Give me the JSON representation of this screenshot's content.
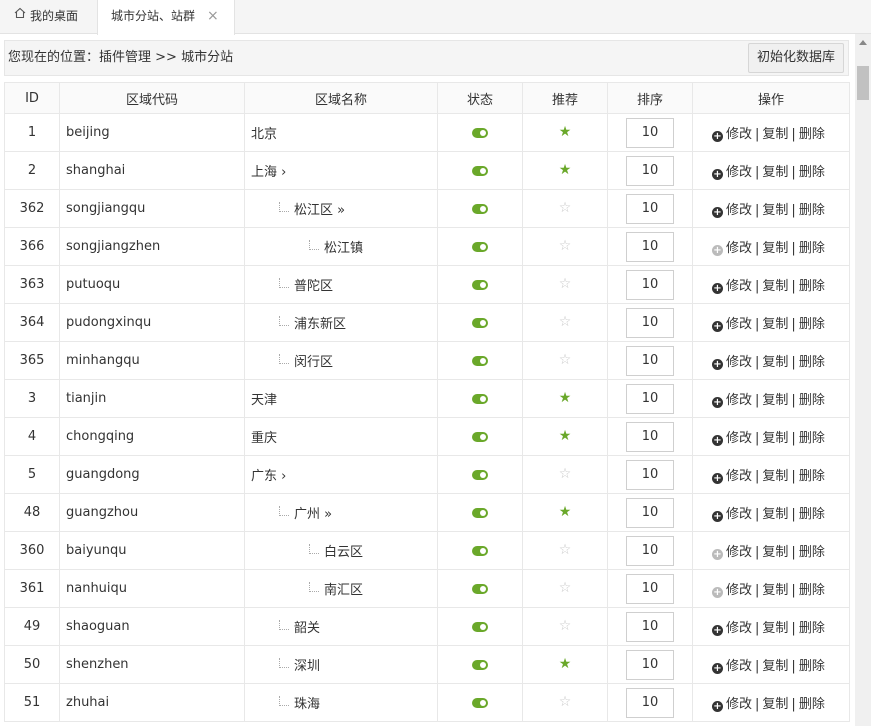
{
  "tabs": {
    "home_label": "我的桌面",
    "active_label": "城市分站、站群",
    "close_glyph": "×"
  },
  "crumb": {
    "prefix": "您现在的位置：",
    "part1": "插件管理",
    "arrow": " >> ",
    "part2": "城市分站"
  },
  "init_button": "初始化数据库",
  "headers": {
    "id": "ID",
    "code": "区域代码",
    "name": "区域名称",
    "state": "状态",
    "recommend": "推荐",
    "sort": "排序",
    "ops": "操作"
  },
  "ops": {
    "edit": "修改",
    "copy": "复制",
    "delete": "删除",
    "sep": "|"
  },
  "colors": {
    "accent": "#6aa82a",
    "star_off": "#c8c8c8"
  },
  "rows": [
    {
      "id": "1",
      "code": "beijing",
      "name": "北京",
      "level": 0,
      "suffix": "",
      "star": true,
      "sort": "10",
      "edit_enabled": true
    },
    {
      "id": "2",
      "code": "shanghai",
      "name": "上海",
      "level": 0,
      "suffix": "›",
      "star": true,
      "sort": "10",
      "edit_enabled": true
    },
    {
      "id": "362",
      "code": "songjiangqu",
      "name": "松江区",
      "level": 1,
      "suffix": "»",
      "star": false,
      "sort": "10",
      "edit_enabled": true
    },
    {
      "id": "366",
      "code": "songjiangzhen",
      "name": "松江镇",
      "level": 2,
      "suffix": "",
      "star": false,
      "sort": "10",
      "edit_enabled": false
    },
    {
      "id": "363",
      "code": "putuoqu",
      "name": "普陀区",
      "level": 1,
      "suffix": "",
      "star": false,
      "sort": "10",
      "edit_enabled": true
    },
    {
      "id": "364",
      "code": "pudongxinqu",
      "name": "浦东新区",
      "level": 1,
      "suffix": "",
      "star": false,
      "sort": "10",
      "edit_enabled": true
    },
    {
      "id": "365",
      "code": "minhangqu",
      "name": "闵行区",
      "level": 1,
      "suffix": "",
      "star": false,
      "sort": "10",
      "edit_enabled": true
    },
    {
      "id": "3",
      "code": "tianjin",
      "name": "天津",
      "level": 0,
      "suffix": "",
      "star": true,
      "sort": "10",
      "edit_enabled": true
    },
    {
      "id": "4",
      "code": "chongqing",
      "name": "重庆",
      "level": 0,
      "suffix": "",
      "star": true,
      "sort": "10",
      "edit_enabled": true
    },
    {
      "id": "5",
      "code": "guangdong",
      "name": "广东",
      "level": 0,
      "suffix": "›",
      "star": false,
      "sort": "10",
      "edit_enabled": true
    },
    {
      "id": "48",
      "code": "guangzhou",
      "name": "广州",
      "level": 1,
      "suffix": "»",
      "star": true,
      "sort": "10",
      "edit_enabled": true
    },
    {
      "id": "360",
      "code": "baiyunqu",
      "name": "白云区",
      "level": 2,
      "suffix": "",
      "star": false,
      "sort": "10",
      "edit_enabled": false
    },
    {
      "id": "361",
      "code": "nanhuiqu",
      "name": "南汇区",
      "level": 2,
      "suffix": "",
      "star": false,
      "sort": "10",
      "edit_enabled": false
    },
    {
      "id": "49",
      "code": "shaoguan",
      "name": "韶关",
      "level": 1,
      "suffix": "",
      "star": false,
      "sort": "10",
      "edit_enabled": true
    },
    {
      "id": "50",
      "code": "shenzhen",
      "name": "深圳",
      "level": 1,
      "suffix": "",
      "star": true,
      "sort": "10",
      "edit_enabled": true
    },
    {
      "id": "51",
      "code": "zhuhai",
      "name": "珠海",
      "level": 1,
      "suffix": "",
      "star": false,
      "sort": "10",
      "edit_enabled": true
    }
  ]
}
